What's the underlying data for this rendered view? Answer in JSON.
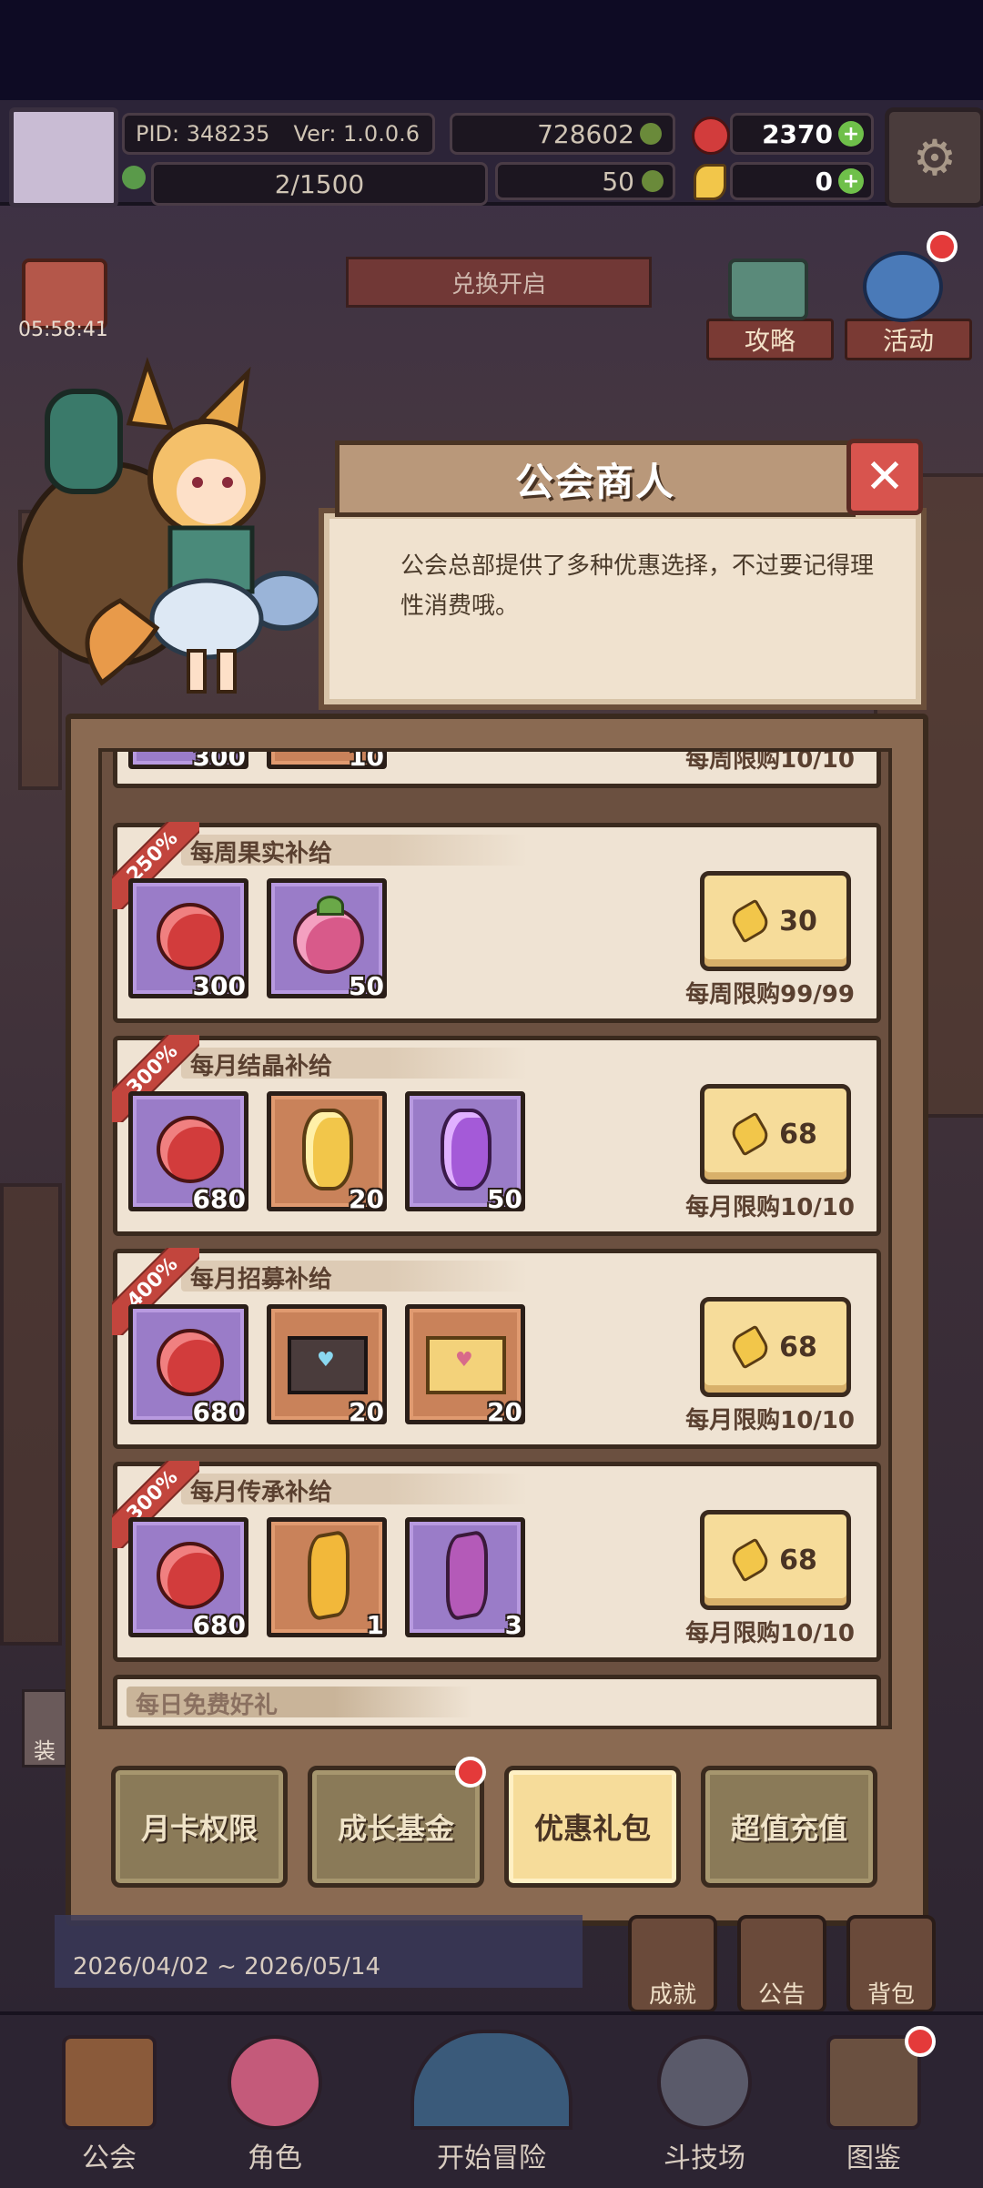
{
  "status": {
    "pid": "PID: 348235",
    "version": "Ver: 1.0.0.6",
    "coins": "728602",
    "gems": "2370",
    "stamina": "2/1500",
    "clover": "50",
    "tickets": "0"
  },
  "event": {
    "timer": "05:58:41",
    "banner": "兑换开启",
    "date_range": "2026/04/02 ~ 2026/05/14"
  },
  "side_buttons": {
    "strategy": "攻略",
    "activity": "活动",
    "achievement": "成就",
    "notice": "公告",
    "bag": "背包",
    "partial_left": "装"
  },
  "dialog": {
    "title": "公会商人",
    "text": "公会总部提供了多种优惠选择，不过要记得理性消费哦。"
  },
  "shop": {
    "partial_top": {
      "limit": "每周限购10/10",
      "qty1": "300",
      "qty2": "10"
    },
    "cards": [
      {
        "ribbon": "250%",
        "title": "每周果实补给",
        "items": [
          {
            "kind": "red-gem",
            "qty": "300"
          },
          {
            "kind": "fruit",
            "qty": "50"
          }
        ],
        "price": "30",
        "limit": "每周限购99/99"
      },
      {
        "ribbon": "300%",
        "title": "每月结晶补给",
        "items": [
          {
            "kind": "red-gem",
            "qty": "680"
          },
          {
            "kind": "gold-gem",
            "qty": "20"
          },
          {
            "kind": "violet-gem",
            "qty": "50"
          }
        ],
        "price": "68",
        "limit": "每月限购10/10"
      },
      {
        "ribbon": "400%",
        "title": "每月招募补给",
        "items": [
          {
            "kind": "red-gem",
            "qty": "680"
          },
          {
            "kind": "dark-letter",
            "qty": "20"
          },
          {
            "kind": "light-letter",
            "qty": "20"
          }
        ],
        "price": "68",
        "limit": "每月限购10/10"
      },
      {
        "ribbon": "300%",
        "title": "每月传承补给",
        "items": [
          {
            "kind": "red-gem",
            "qty": "680"
          },
          {
            "kind": "gold-crystal",
            "qty": "1"
          },
          {
            "kind": "violet-crystal",
            "qty": "3"
          }
        ],
        "price": "68",
        "limit": "每月限购10/10"
      }
    ],
    "partial_bottom_title": "每日免费好礼"
  },
  "tabs": [
    "月卡权限",
    "成长基金",
    "优惠礼包",
    "超值充值"
  ],
  "bottom_nav": [
    "公会",
    "角色",
    "开始冒险",
    "斗技场",
    "图鉴"
  ]
}
